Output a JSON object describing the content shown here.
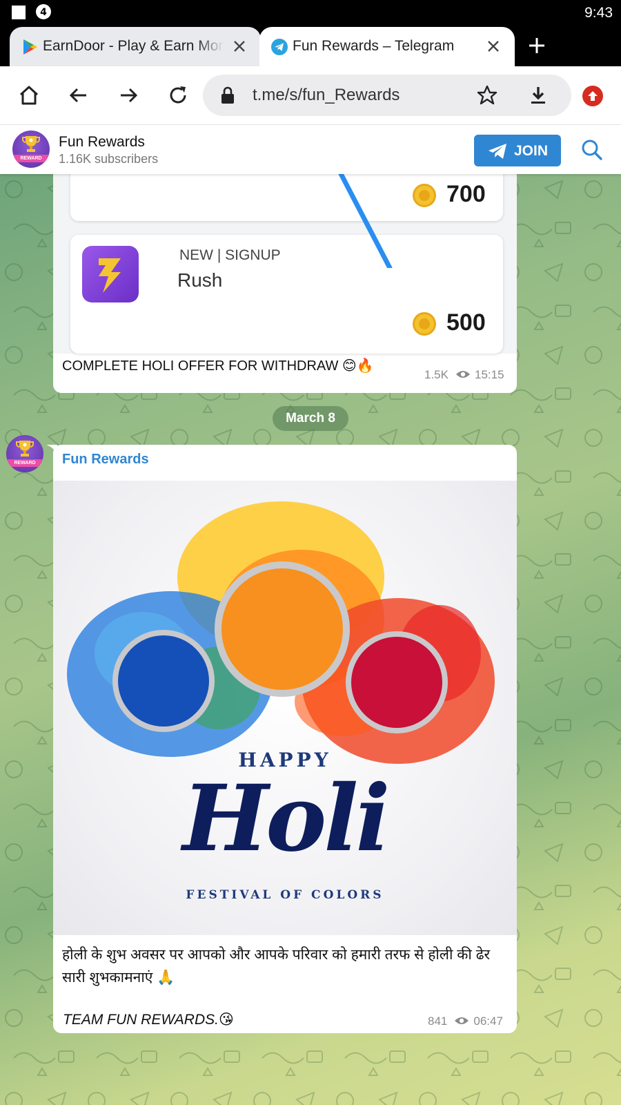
{
  "status_bar": {
    "time": "9:43"
  },
  "tabs": [
    {
      "title": "EarnDoor - Play & Earn Money",
      "icon": "google-play-icon",
      "active": false
    },
    {
      "title": "Fun Rewards – Telegram",
      "icon": "telegram-icon",
      "active": true
    }
  ],
  "toolbar": {
    "url": "t.me/s/fun_Rewards"
  },
  "channel": {
    "name": "Fun Rewards",
    "subscribers": "1.16K subscribers",
    "join_label": "JOIN",
    "avatar_ribbon": "REWARD"
  },
  "messages": [
    {
      "offers": [
        {
          "amount": "700"
        },
        {
          "badge": "NEW | SIGNUP",
          "name": "Rush",
          "amount": "500"
        }
      ],
      "caption": "COMPLETE HOLI OFFER FOR WITHDRAW 😊🔥",
      "views": "1.5K",
      "time": "15:15"
    }
  ],
  "date_separator": "March 8",
  "post": {
    "author": "Fun Rewards",
    "image": {
      "happy": "HAPPY",
      "holi": "Holi",
      "subtitle": "FESTIVAL OF COLORS"
    },
    "text": "होली के शुभ अवसर पर आपको और आपके परिवार को हमारी तरफ से होली की ढेर सारी शुभकामनाएं 🙏",
    "signature": "TEAM FUN REWARDS.😘",
    "views": "841",
    "time": "06:47"
  },
  "colors": {
    "telegram_blue": "#2f86d3",
    "update_red": "#d62c20"
  }
}
